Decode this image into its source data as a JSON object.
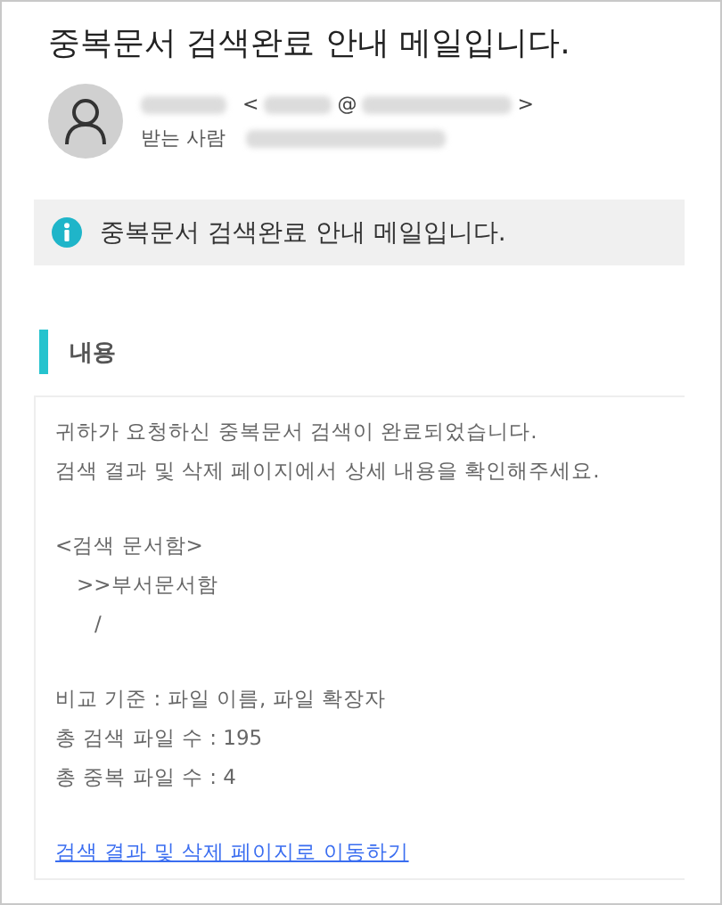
{
  "subject": "중복문서 검색완료 안내 메일입니다.",
  "sender": {
    "open_bracket": "<",
    "at": "@",
    "close_bracket": ">",
    "recipient_label": "받는 사람"
  },
  "notice": {
    "text": "중복문서 검색완료 안내 메일입니다."
  },
  "section": {
    "heading": "내용"
  },
  "body": {
    "intro": [
      "귀하가 요청하신 중복문서 검색이 완료되었습니다.",
      "검색 결과 및 삭제 페이지에서 상세 내용을 확인해주세요."
    ],
    "folders": [
      {
        "label": "<검색 문서함>",
        "children": [
          {
            "label": ">>부서문서함",
            "children": [
              {
                "label": "/"
              }
            ]
          }
        ]
      }
    ],
    "stats": [
      "비교 기준 : 파일 이름, 파일 확장자",
      "총 검색 파일 수 : 195",
      "총 중복 파일 수 : 4"
    ],
    "link": "검색 결과 및 삭제 페이지로 이동하기"
  }
}
